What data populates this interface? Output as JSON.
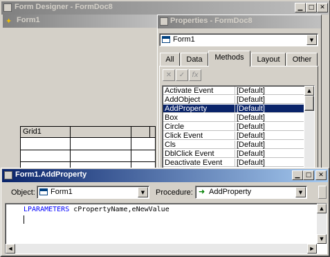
{
  "designer": {
    "title": "Form Designer - FormDoc8",
    "form_title": "Form1",
    "grid_label": "Grid1"
  },
  "properties": {
    "title": "Properties - FormDoc8",
    "object_selected": "Form1",
    "tabs": [
      "All",
      "Data",
      "Methods",
      "Layout",
      "Other"
    ],
    "active_tab": "Methods",
    "toolbar": [
      "✕",
      "✓",
      "fx"
    ],
    "rows": [
      {
        "name": "Activate Event",
        "value": "[Default]"
      },
      {
        "name": "AddObject",
        "value": "[Default]"
      },
      {
        "name": "AddProperty",
        "value": "[Default]",
        "selected": true
      },
      {
        "name": "Box",
        "value": "[Default]"
      },
      {
        "name": "Circle",
        "value": "[Default]"
      },
      {
        "name": "Click Event",
        "value": "[Default]"
      },
      {
        "name": "Cls",
        "value": "[Default]"
      },
      {
        "name": "DblClick Event",
        "value": "[Default]"
      },
      {
        "name": "Deactivate Event",
        "value": "[Default]"
      }
    ]
  },
  "code_window": {
    "title": "Form1.AddProperty",
    "object_label": "Object:",
    "object_value": "Form1",
    "procedure_label": "Procedure:",
    "procedure_value": "AddProperty",
    "code_keyword": "LPARAMETERS",
    "code_rest": " cPropertyName,eNewValue"
  },
  "colors": {
    "title_active_start": "#0a246a",
    "title_active_end": "#a6caf0",
    "title_inactive_start": "#808080",
    "title_inactive_end": "#c0c0c0",
    "selection": "#0a246a",
    "keyword": "#0000ff"
  }
}
